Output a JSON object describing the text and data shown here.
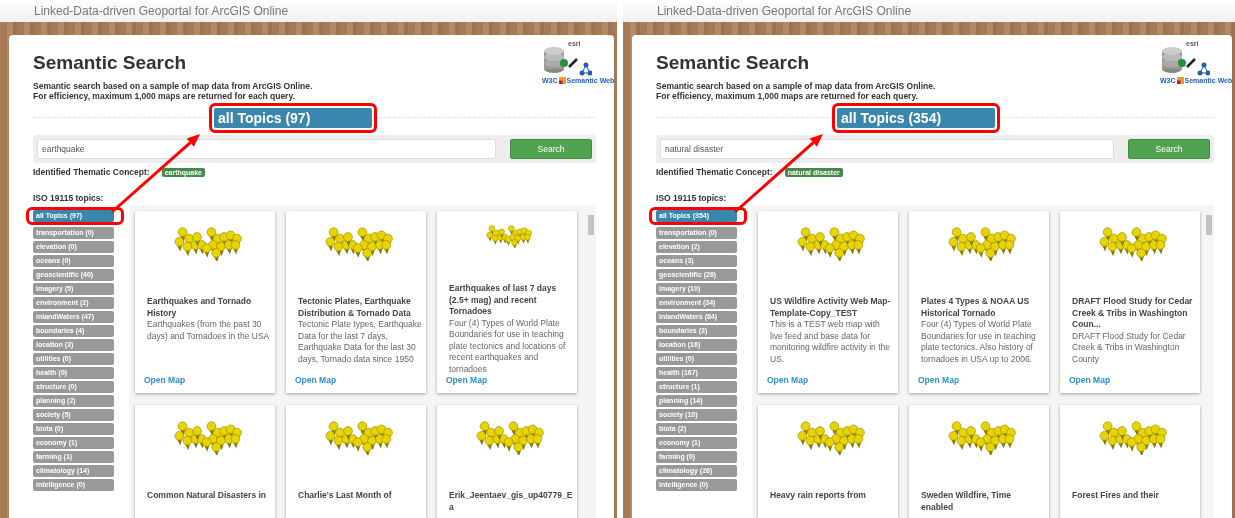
{
  "panels": [
    {
      "site_title": "Linked-Data-driven Geoportal for ArcGIS Online",
      "title": "Semantic Search",
      "description": [
        "Semantic search based on a sample of map data from ArcGIS Online.",
        "For efficiency, maximum 1,000 maps are returned for each query."
      ],
      "logo": {
        "top": "esri",
        "bottom": "W3C",
        "tag": "Semantic Web"
      },
      "callout": "all Topics (97)",
      "search": {
        "value": "earthquake",
        "button": "Search"
      },
      "concept_label": "Identified Thematic Concept:",
      "concept_tag": "earthquake",
      "topics_label": "ISO 19115 topics:",
      "topics": [
        {
          "label": "all Topics (97)",
          "selected": true
        },
        {
          "label": "transportation (0)",
          "selected": false
        },
        {
          "label": "elevation (0)",
          "selected": false
        },
        {
          "label": "oceans (0)",
          "selected": false
        },
        {
          "label": "geoscientific (40)",
          "selected": false
        },
        {
          "label": "imagery (5)",
          "selected": false
        },
        {
          "label": "environment (2)",
          "selected": false
        },
        {
          "label": "inlandWaters (47)",
          "selected": false
        },
        {
          "label": "boundaries (4)",
          "selected": false
        },
        {
          "label": "location (3)",
          "selected": false
        },
        {
          "label": "utilities (0)",
          "selected": false
        },
        {
          "label": "health (0)",
          "selected": false
        },
        {
          "label": "structure (0)",
          "selected": false
        },
        {
          "label": "planning (2)",
          "selected": false
        },
        {
          "label": "society (5)",
          "selected": false
        },
        {
          "label": "biota (0)",
          "selected": false
        },
        {
          "label": "economy (1)",
          "selected": false
        },
        {
          "label": "farming (1)",
          "selected": false
        },
        {
          "label": "climatology (14)",
          "selected": false
        },
        {
          "label": "intelligence (0)",
          "selected": false
        }
      ],
      "cards": [
        {
          "title": "Earthquakes and Tornado History",
          "description": "Earthquakes (from the past 30 days) and Tornadoes in the USA",
          "link": "Open Map"
        },
        {
          "title": "Tectonic Plates, Earthquake Distribution & Tornado Data",
          "description": "Tectonic Plate types, Earthquake Data for the last 7 days, Earthquake Data for the last 30 days, Tornado data since 1950",
          "link": "Open Map"
        },
        {
          "title": "Earthquakes of last 7 days (2.5+ mag) and recent Tornadoes",
          "description": "Four (4) Types of World Plate Boundaries for use in teaching plate tectonics and locations of recent earthquakes and tornadoes",
          "link": "Open Map"
        },
        {
          "title": "Common Natural Disasters in"
        },
        {
          "title": "Charlie's Last Month of"
        },
        {
          "title": "Erik_Jeentaev_gis_up40779_Ea"
        }
      ]
    },
    {
      "site_title": "Linked-Data-driven Geoportal for ArcGIS Online",
      "title": "Semantic Search",
      "description": [
        "Semantic search based on a sample of map data from ArcGIS Online.",
        "For efficiency, maximum 1,000 maps are returned for each query."
      ],
      "logo": {
        "top": "esri",
        "bottom": "W3C",
        "tag": "Semantic Web"
      },
      "callout": "all Topics (354)",
      "search": {
        "value": "natural disaster",
        "button": "Search"
      },
      "concept_label": "Identified Thematic Concept:",
      "concept_tag": "natural disaster",
      "topics_label": "ISO 19115 topics:",
      "topics": [
        {
          "label": "all Topics (354)",
          "selected": true
        },
        {
          "label": "transportation (0)",
          "selected": false
        },
        {
          "label": "elevation (2)",
          "selected": false
        },
        {
          "label": "oceans (3)",
          "selected": false
        },
        {
          "label": "geoscientific (26)",
          "selected": false
        },
        {
          "label": "imagery (10)",
          "selected": false
        },
        {
          "label": "environment (34)",
          "selected": false
        },
        {
          "label": "inlandWaters (84)",
          "selected": false
        },
        {
          "label": "boundaries (3)",
          "selected": false
        },
        {
          "label": "location (16)",
          "selected": false
        },
        {
          "label": "utilities (0)",
          "selected": false
        },
        {
          "label": "health (167)",
          "selected": false
        },
        {
          "label": "structure (1)",
          "selected": false
        },
        {
          "label": "planning (14)",
          "selected": false
        },
        {
          "label": "society (10)",
          "selected": false
        },
        {
          "label": "biota (2)",
          "selected": false
        },
        {
          "label": "economy (1)",
          "selected": false
        },
        {
          "label": "farming (0)",
          "selected": false
        },
        {
          "label": "climatology (26)",
          "selected": false
        },
        {
          "label": "intelligence (0)",
          "selected": false
        }
      ],
      "cards": [
        {
          "title": "US Wildfire Activity Web Map-Template-Copy_TEST",
          "description": "This is a TEST web map with live feed and base data for monitoring wildfire activity in the US.",
          "link": "Open Map"
        },
        {
          "title": "Plates 4 Types & NOAA US Historical Tornado",
          "description": "Four (4) Types of World Plate Boundaries for use in teaching plate tectonics. Also history of tornadoes in USA up to 2006.",
          "link": "Open Map"
        },
        {
          "title": "DRAFT Flood Study for Cedar Creek & Tribs in Washington Coun...",
          "description": "DRAFT Flood Study for Cedar Creek & Tribs in Washington County",
          "link": "Open Map"
        },
        {
          "title": "Heavy rain reports from"
        },
        {
          "title": "Sweden Wildfire, Time enabled"
        },
        {
          "title": "Forest Fires and their"
        }
      ]
    }
  ]
}
